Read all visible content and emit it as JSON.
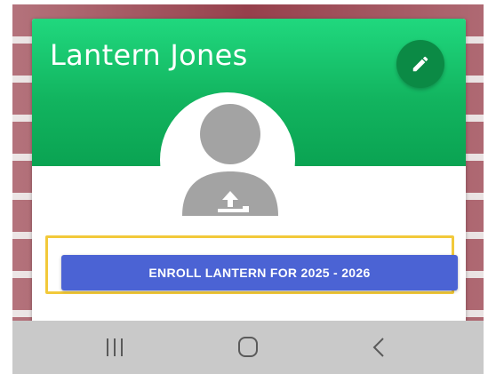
{
  "profile": {
    "name": "Lantern Jones"
  },
  "actions": {
    "enroll_label": "ENROLL LANTERN FOR 2025 - 2026"
  },
  "icons": {
    "edit": "pencil-icon",
    "avatar": "avatar-upload-icon",
    "nav_recents": "recents-icon",
    "nav_home": "home-icon",
    "nav_back": "back-icon"
  },
  "colors": {
    "header_green": "#12b45f",
    "edit_button": "#0b8a45",
    "enroll_button": "#4b63d4",
    "highlight": "#f2c93a",
    "navbar": "#c9c9c9"
  }
}
